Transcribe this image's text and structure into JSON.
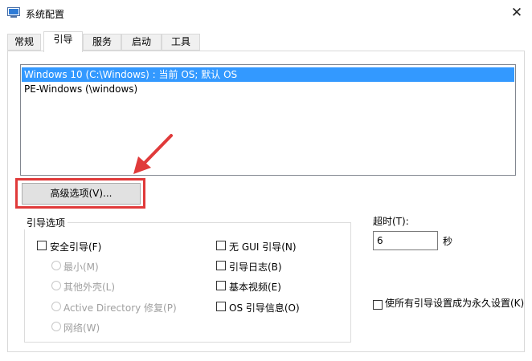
{
  "window": {
    "title": "系统配置",
    "close_glyph": "✕"
  },
  "tabs": [
    {
      "label": "常规",
      "active": false
    },
    {
      "label": "引导",
      "active": true
    },
    {
      "label": "服务",
      "active": false
    },
    {
      "label": "启动",
      "active": false
    },
    {
      "label": "工具",
      "active": false
    }
  ],
  "boot_list": [
    {
      "text": "Windows 10 (C:\\Windows) : 当前 OS; 默认 OS",
      "selected": true
    },
    {
      "text": "PE-Windows (\\windows)",
      "selected": false
    }
  ],
  "advanced_button": {
    "label": "高级选项(V)..."
  },
  "boot_options": {
    "title": "引导选项",
    "safe_boot": {
      "label": "安全引导(F)",
      "checked": false
    },
    "radios": [
      {
        "label": "最小(M)"
      },
      {
        "label": "其他外壳(L)"
      },
      {
        "label": "Active Directory 修复(P)"
      },
      {
        "label": "网络(W)"
      }
    ],
    "right_checks": [
      {
        "label": "无 GUI 引导(N)",
        "checked": false
      },
      {
        "label": "引导日志(B)",
        "checked": false
      },
      {
        "label": "基本视频(E)",
        "checked": false
      },
      {
        "label": "OS 引导信息(O)",
        "checked": false
      }
    ]
  },
  "timeout": {
    "label": "超时(T):",
    "value": "6",
    "unit": "秒"
  },
  "permanent": {
    "label": "使所有引导设置成为永久设置(K)",
    "checked": false
  },
  "colors": {
    "selection": "#3399ff",
    "highlight": "#e03a3a"
  }
}
